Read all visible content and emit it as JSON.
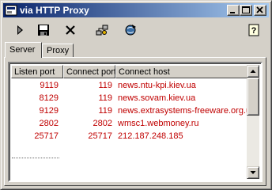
{
  "window": {
    "title": "via HTTP Proxy",
    "icon": "proxy-app-icon",
    "title_bar_color": "#0a246a"
  },
  "toolbar": {
    "buttons": [
      {
        "icon": "play-icon",
        "name": "start"
      },
      {
        "icon": "save-icon",
        "name": "save"
      },
      {
        "icon": "delete-icon",
        "name": "delete"
      },
      {
        "icon": "connect-icon",
        "name": "connect"
      },
      {
        "icon": "network-icon",
        "name": "network"
      },
      {
        "icon": "help-icon",
        "name": "help"
      }
    ]
  },
  "tabs": [
    {
      "label": "Server",
      "active": true
    },
    {
      "label": "Proxy",
      "active": false
    }
  ],
  "table": {
    "columns": [
      "Listen port",
      "Connect port",
      "Connect host"
    ],
    "rows": [
      {
        "listen": "9119",
        "connect": "119",
        "host": "news.ntu-kpi.kiev.ua"
      },
      {
        "listen": "8129",
        "connect": "119",
        "host": "news.sovam.kiev.ua"
      },
      {
        "listen": "9129",
        "connect": "119",
        "host": "news.extrasystems-freeware.org.ua"
      },
      {
        "listen": "2802",
        "connect": "2802",
        "host": "wmsc1.webmoney.ru"
      },
      {
        "listen": "25717",
        "connect": "25717",
        "host": "212.187.248.185"
      }
    ],
    "text_color": "#c00000"
  }
}
